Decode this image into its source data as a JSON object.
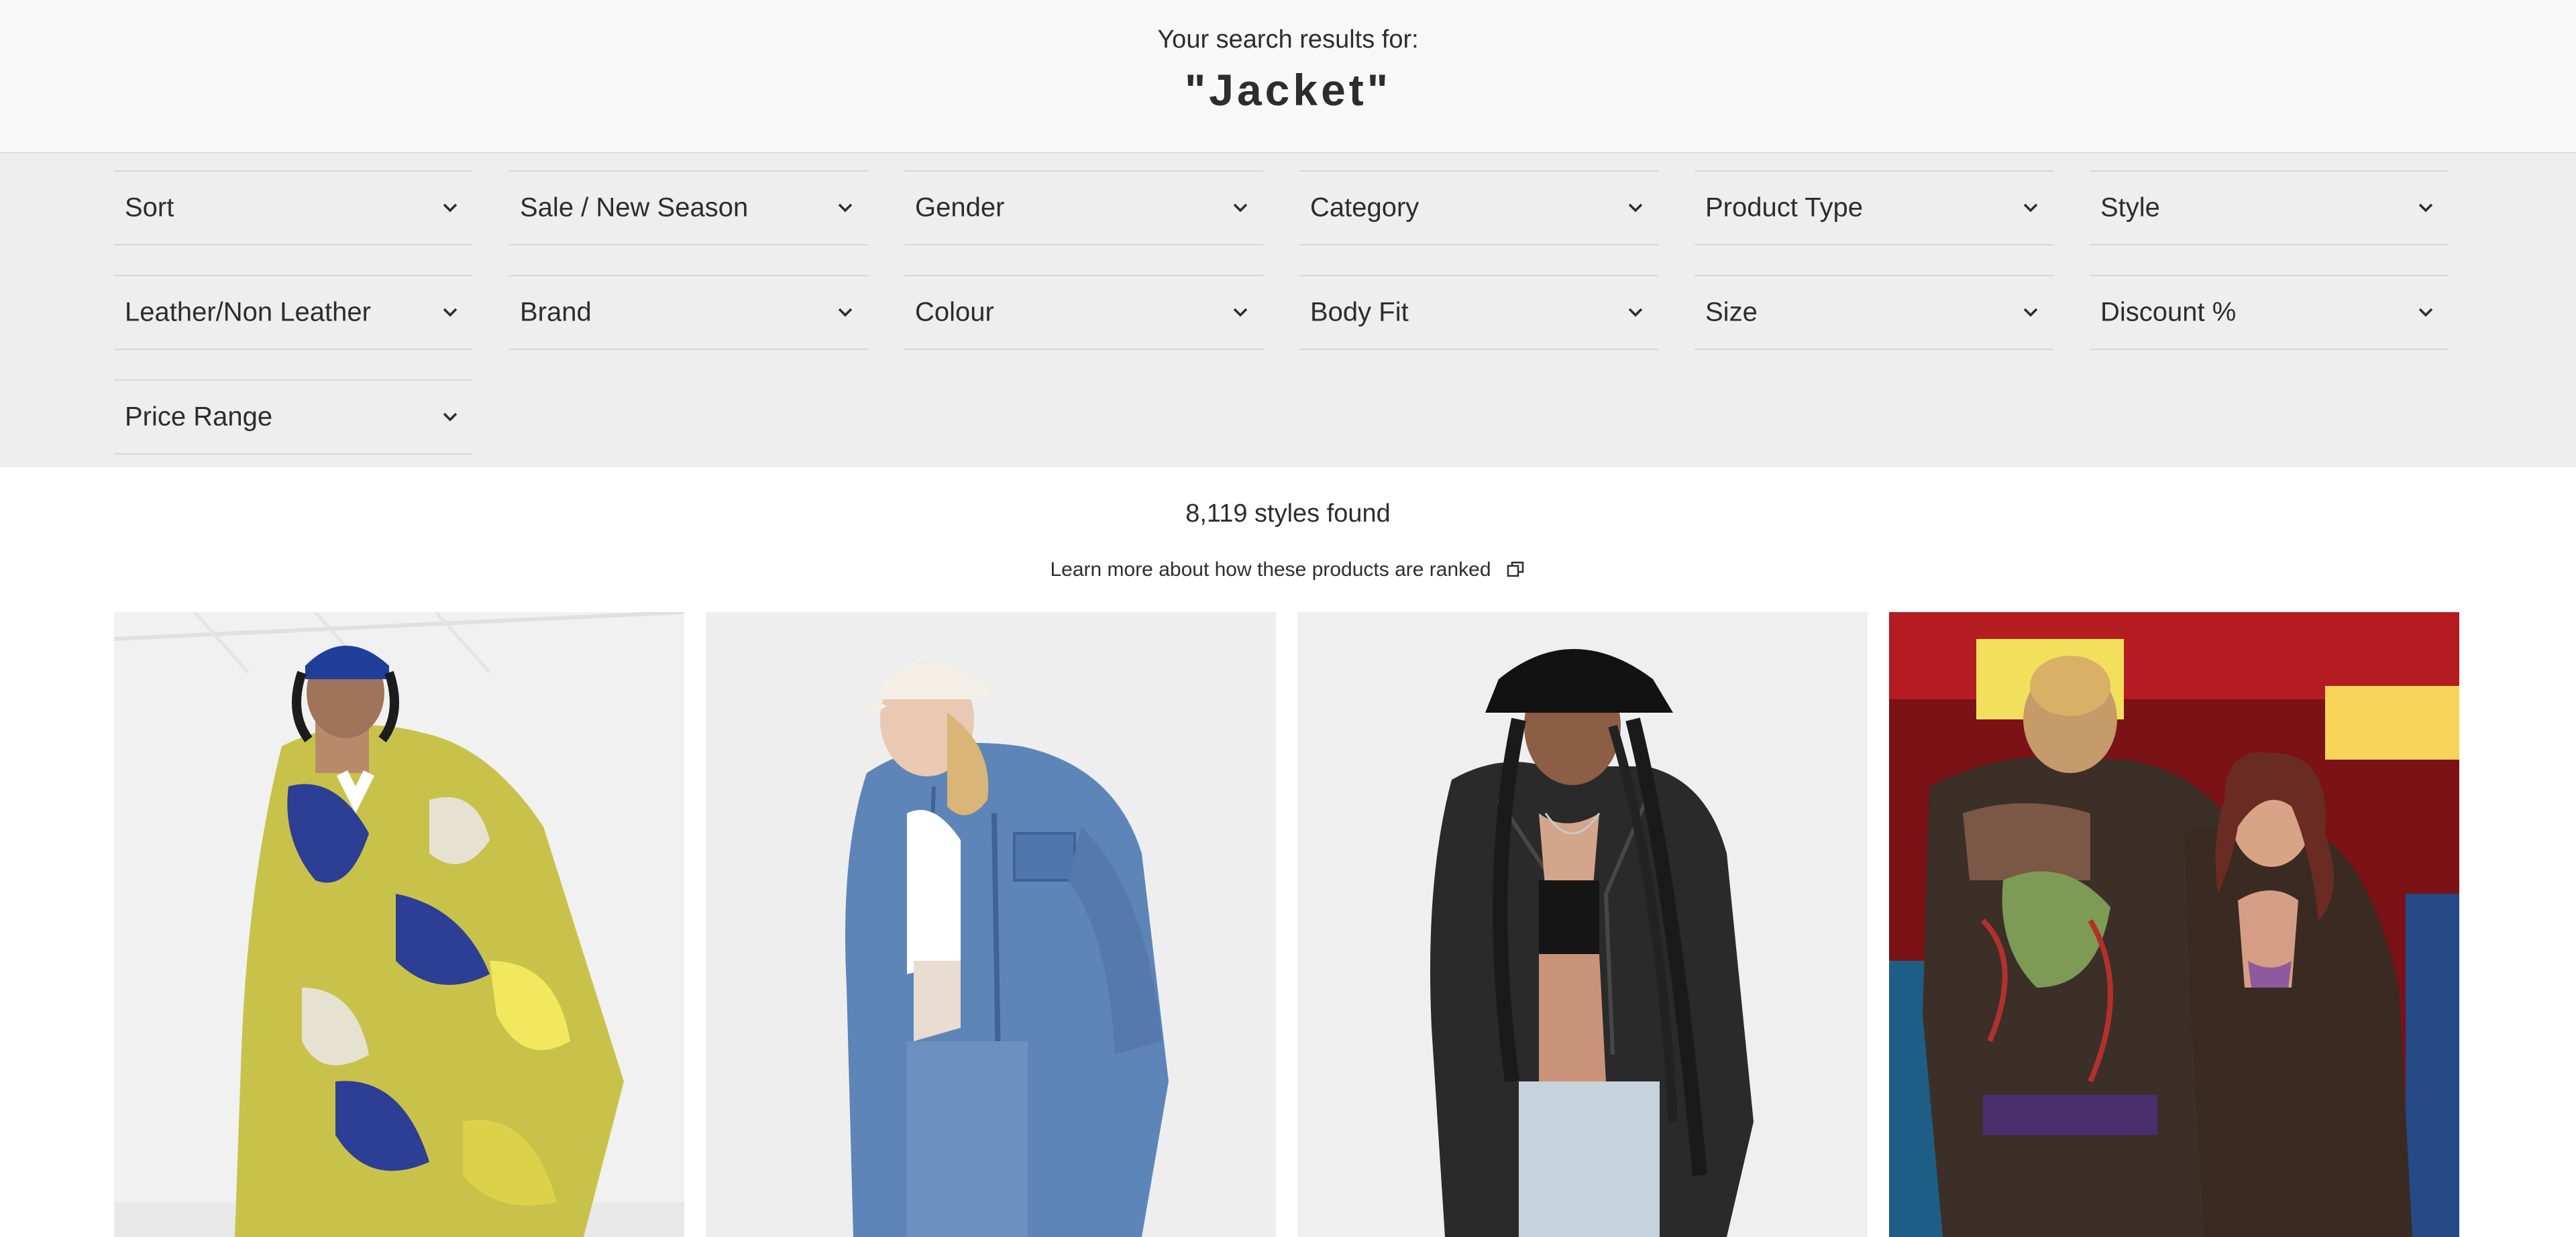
{
  "search": {
    "prefix": "Your search results for:",
    "term": "\"Jacket\""
  },
  "filters": [
    {
      "label": "Sort"
    },
    {
      "label": "Sale / New Season"
    },
    {
      "label": "Gender"
    },
    {
      "label": "Category"
    },
    {
      "label": "Product Type"
    },
    {
      "label": "Style"
    },
    {
      "label": "Leather/Non Leather"
    },
    {
      "label": "Brand"
    },
    {
      "label": "Colour"
    },
    {
      "label": "Body Fit"
    },
    {
      "label": "Size"
    },
    {
      "label": "Discount %"
    },
    {
      "label": "Price Range"
    }
  ],
  "results": {
    "count_text": "8,119 styles found",
    "learn_more": "Learn more about how these products are ranked"
  },
  "products": [
    {
      "name": "product-image-tie-dye-jacket"
    },
    {
      "name": "product-image-denim-jacket"
    },
    {
      "name": "product-image-leather-biker-jacket"
    },
    {
      "name": "product-image-graphic-jacket"
    }
  ],
  "colors": {
    "header_bg": "#f8f8f8",
    "filter_bg": "#eeeeee",
    "text": "#2d2d2d"
  },
  "icons": {
    "chevron": "chevron-down-icon",
    "copy": "copy-icon"
  }
}
